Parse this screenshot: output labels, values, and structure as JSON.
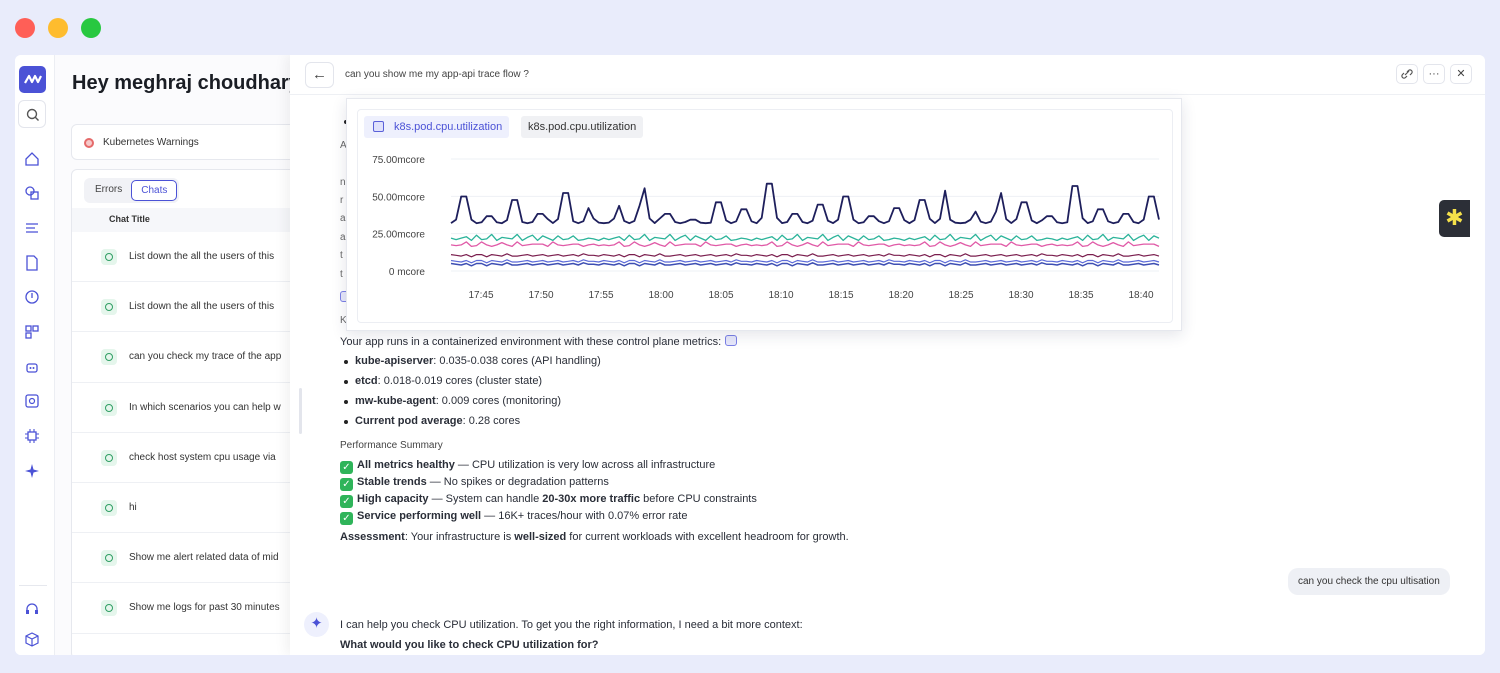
{
  "window_controls": [
    {
      "name": "close",
      "color": "#ff5f57"
    },
    {
      "name": "minimize",
      "color": "#febc2e"
    },
    {
      "name": "maximize",
      "color": "#28c840"
    }
  ],
  "home": {
    "greeting": "Hey meghraj choudhary,",
    "warning_card": "Kubernetes Warnings",
    "tabs": [
      "Errors",
      "Chats"
    ],
    "column_header": "Chat Title",
    "chats": [
      "List down the all the users of this",
      "List down the all the users of this",
      "can you check my trace of the app",
      "In which scenarios you can help w",
      "check host system cpu usage via",
      "hi",
      "Show me alert related data of mid",
      "Show me logs for past 30 minutes"
    ]
  },
  "drawer": {
    "title": "can you show me my app-api trace flow ?",
    "back_icon": "←",
    "link_icon": "🔗",
    "more_icon": "···",
    "close_icon": "✕"
  },
  "peek_chars": {
    "a1": "A",
    "n": "n",
    "r": "r",
    "a2": "a",
    "a3": "a",
    "t1": "t",
    "t2": "t",
    "k": "K"
  },
  "chart_tabs": [
    "k8s.pod.cpu.utilization",
    "k8s.pod.cpu.utilization"
  ],
  "chart_data": {
    "type": "line",
    "ylabel": "",
    "y_ticks": [
      "75.00mcore",
      "50.00mcore",
      "25.00mcore",
      "0 mcore"
    ],
    "ylim": [
      0,
      75
    ],
    "x_ticks": [
      "17:45",
      "17:50",
      "17:55",
      "18:00",
      "18:05",
      "18:10",
      "18:15",
      "18:20",
      "18:25",
      "18:30",
      "18:35",
      "18:40"
    ],
    "series_colors": [
      "#1e1f5c",
      "#2bb39a",
      "#e05aa7",
      "#3e4fb3",
      "#7a1e4e",
      "#5d6bd8"
    ],
    "series_note_values": {
      "peak_series_mcore": [
        55,
        38,
        52,
        40,
        58,
        45,
        36,
        47,
        62,
        40,
        35,
        50,
        44,
        66,
        40,
        48,
        55,
        38,
        45,
        52,
        60,
        35,
        42,
        58,
        50,
        38,
        64,
        44,
        40,
        55
      ],
      "teal_series_mcore": [
        20,
        22,
        21,
        24,
        20,
        23,
        22,
        21,
        25,
        20,
        22,
        24,
        21,
        23,
        20,
        22,
        26,
        21,
        23,
        22,
        20,
        24,
        22,
        21,
        23,
        20,
        22,
        24,
        21,
        20
      ],
      "pink_series_mcore": [
        16,
        18,
        17,
        19,
        16,
        18,
        20,
        17,
        16,
        19,
        18,
        17,
        16,
        20,
        18,
        17,
        19,
        16,
        18,
        17,
        20,
        18,
        16,
        19,
        17,
        18,
        16,
        19,
        18,
        17
      ],
      "low_series_mcore": [
        4,
        5,
        3,
        6,
        4,
        5,
        4,
        3,
        5,
        6,
        4,
        5,
        3,
        4,
        6,
        5,
        4,
        3,
        5,
        4,
        6,
        5,
        4,
        3,
        5,
        4,
        6,
        5,
        4,
        5
      ]
    }
  },
  "answer": {
    "intro": "Your app runs in a containerized environment with these control plane metrics:",
    "metrics": [
      {
        "name": "kube-apiserver",
        "value": ": 0.035-0.038 cores (API handling)"
      },
      {
        "name": "etcd",
        "value": ": 0.018-0.019 cores (cluster state)"
      },
      {
        "name": "mw-kube-agent",
        "value": ": 0.009 cores (monitoring)"
      },
      {
        "name": "Current pod average",
        "value": ": 0.28 cores"
      }
    ],
    "summary_heading": "Performance Summary",
    "summary": [
      {
        "bold": "All metrics healthy",
        "rest": " — CPU utilization is very low across all infrastructure"
      },
      {
        "bold": "Stable trends",
        "rest": " — No spikes or degradation patterns"
      },
      {
        "bold": "High capacity",
        "rest": " — System can handle ",
        "bold2": "20-30x more traffic",
        "rest2": " before CPU constraints"
      },
      {
        "bold": "Service performing well",
        "rest": " — 16K+ traces/hour with 0.07% error rate"
      }
    ],
    "assessment_label": "Assessment",
    "assessment_a": ": Your infrastructure is ",
    "assessment_bold": "well-sized",
    "assessment_b": " for current workloads with excellent headroom for growth."
  },
  "user_message": "can you check the cpu ultisation",
  "ai_reply": {
    "line1": "I can help you check CPU utilization. To get you the right information, I need a bit more context:",
    "line2": "What would you like to check CPU utilization for?"
  },
  "assistant_fab_icon": "✱"
}
